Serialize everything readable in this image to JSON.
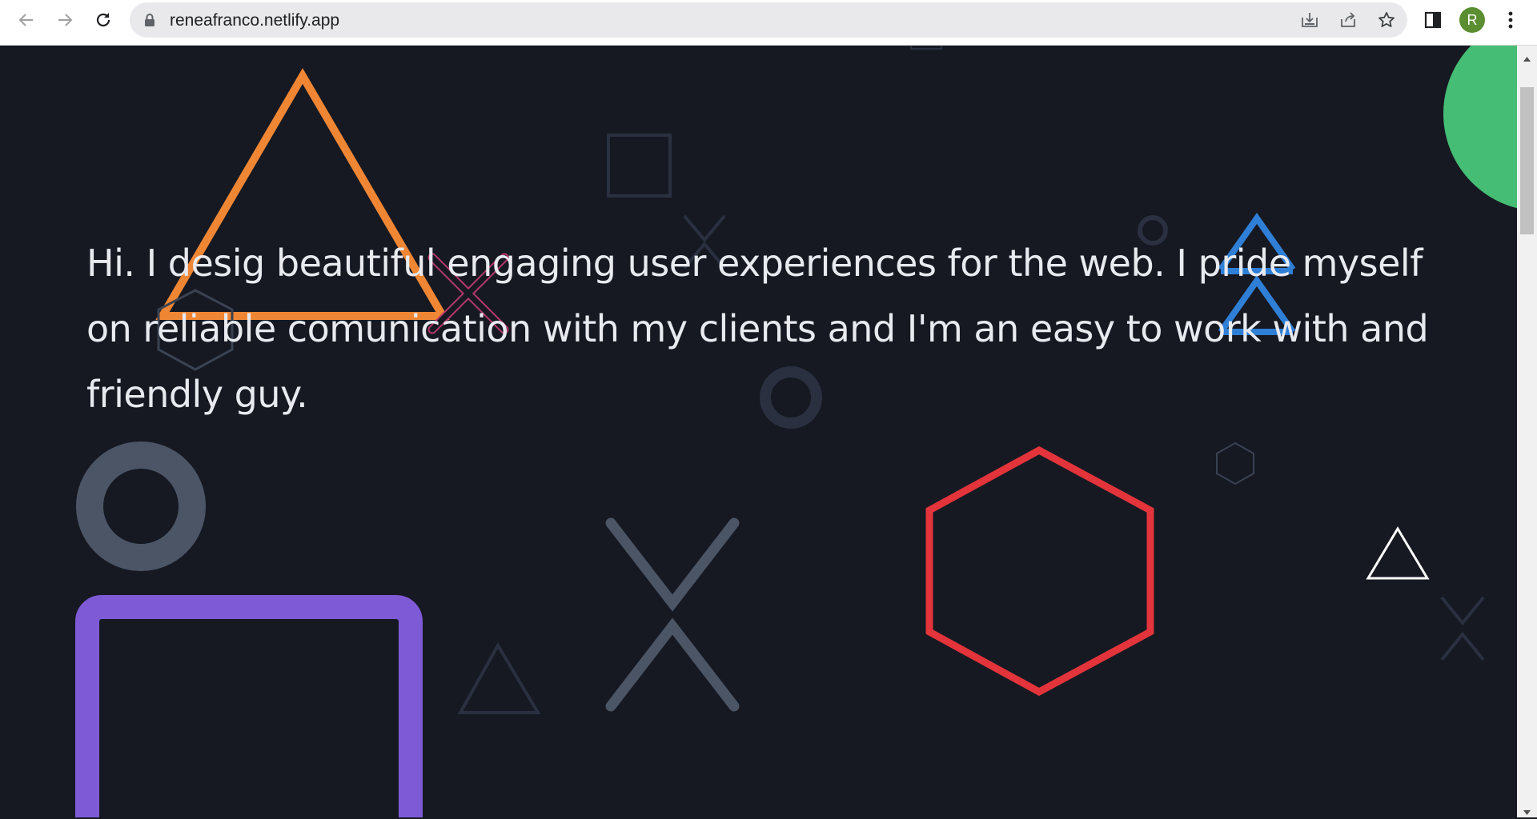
{
  "browser": {
    "url": "reneafranco.netlify.app",
    "profile_initial": "R",
    "profile_color": "#5b8d31",
    "icons": [
      "back-icon",
      "forward-icon",
      "reload-icon",
      "lock-icon",
      "install-icon",
      "share-icon",
      "star-icon",
      "side-panel-icon",
      "menu-icon"
    ]
  },
  "page": {
    "intro": "Hi. I desig beautiful engaging user experiences for the web. I pride myself on reliable comunication with my clients and I'm an easy to work with and friendly guy.",
    "background_color": "#161922",
    "accent_colors": {
      "orange": "#ef8634",
      "purple": "#7f5ad6",
      "red": "#e3343b",
      "blue": "#2f7fd6",
      "green": "#45bd74",
      "gray": "#4b5566",
      "pink": "#b5386b"
    }
  }
}
